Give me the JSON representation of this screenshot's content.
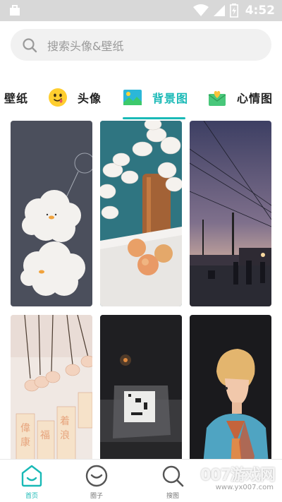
{
  "status_bar": {
    "time": "4:52"
  },
  "search": {
    "placeholder": "搜索头像&壁纸"
  },
  "tabs": [
    {
      "label": "壁纸",
      "icon": "wallpaper"
    },
    {
      "label": "头像",
      "icon": "face-emoji-icon"
    },
    {
      "label": "背景图",
      "icon": "landscape-image-icon",
      "active": true
    },
    {
      "label": "心情图",
      "icon": "heart-envelope-icon"
    }
  ],
  "grid": [
    {
      "name": "cloud-ducks-photo"
    },
    {
      "name": "orchid-peaches-photo"
    },
    {
      "name": "dusk-street-photo"
    },
    {
      "name": "wind-chimes-photo"
    },
    {
      "name": "dark-window-photo"
    },
    {
      "name": "blond-man-photo"
    }
  ],
  "bottom_nav": [
    {
      "label": "首页",
      "icon": "home-icon",
      "active": true
    },
    {
      "label": "圈子",
      "icon": "smile-circle-icon"
    },
    {
      "label": "搜图",
      "icon": "search-icon"
    }
  ],
  "watermark": {
    "main": "007游戏网",
    "sub": "www.yx007.com"
  },
  "colors": {
    "accent": "#19b9b6",
    "search_bg": "#f1f1f1",
    "status_bg": "#d8d8d8"
  }
}
